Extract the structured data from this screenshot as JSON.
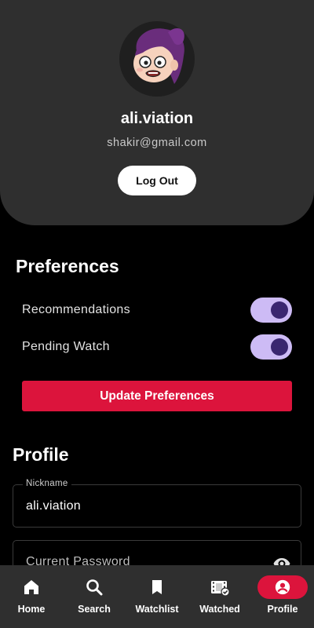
{
  "profile_header": {
    "username": "ali.viation",
    "email": "shakir@gmail.com",
    "logout_label": "Log Out",
    "avatar_icon": "cartoon-avatar"
  },
  "preferences": {
    "title": "Preferences",
    "items": [
      {
        "label": "Recommendations",
        "enabled": true
      },
      {
        "label": "Pending Watch",
        "enabled": true
      }
    ],
    "update_label": "Update Preferences"
  },
  "profile": {
    "title": "Profile",
    "nickname": {
      "label": "Nickname",
      "value": "ali.viation"
    },
    "current_password": {
      "placeholder": "Current Password",
      "icon": "eye-icon"
    }
  },
  "nav": {
    "items": [
      {
        "label": "Home",
        "icon": "home-icon",
        "active": false
      },
      {
        "label": "Search",
        "icon": "search-icon",
        "active": false
      },
      {
        "label": "Watchlist",
        "icon": "bookmark-icon",
        "active": false
      },
      {
        "label": "Watched",
        "icon": "film-check-icon",
        "active": false
      },
      {
        "label": "Profile",
        "icon": "account-icon",
        "active": true
      }
    ]
  },
  "colors": {
    "accent": "#dc143c",
    "toggle_track": "#cdbbf5",
    "toggle_knob": "#3a2670",
    "card_bg": "#2f2f2f"
  }
}
